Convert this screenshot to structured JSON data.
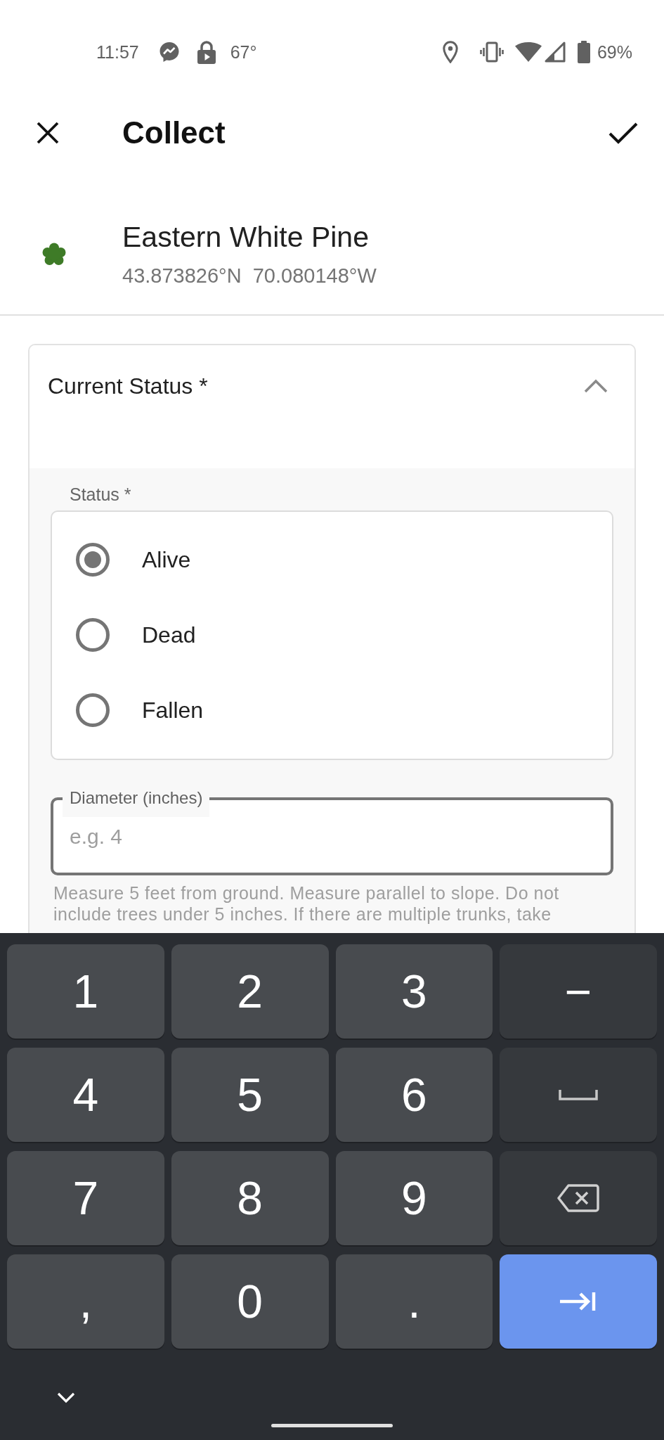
{
  "status_bar": {
    "time": "11:57",
    "temperature": "67°",
    "battery": "69%"
  },
  "app_bar": {
    "title": "Collect"
  },
  "species": {
    "name": "Eastern White Pine",
    "coordinates": "43.873826°N  70.080148°W"
  },
  "section": {
    "title": "Current Status *",
    "expanded": true,
    "status": {
      "label": "Status *",
      "options": [
        {
          "label": "Alive",
          "selected": true
        },
        {
          "label": "Dead",
          "selected": false
        },
        {
          "label": "Fallen",
          "selected": false
        }
      ]
    },
    "diameter": {
      "label": "Diameter (inches)",
      "placeholder": "e.g. 4",
      "focused": true,
      "help": "Measure 5 feet from ground. Measure parallel to slope. Do not include trees under 5 inches. If there are multiple trunks, take"
    }
  },
  "keyboard": {
    "rows": [
      [
        {
          "kind": "char",
          "label": "1"
        },
        {
          "kind": "char",
          "label": "2"
        },
        {
          "kind": "char",
          "label": "3"
        },
        {
          "kind": "symbol",
          "label": "−"
        }
      ],
      [
        {
          "kind": "char",
          "label": "4"
        },
        {
          "kind": "char",
          "label": "5"
        },
        {
          "kind": "char",
          "label": "6"
        },
        {
          "kind": "space"
        }
      ],
      [
        {
          "kind": "char",
          "label": "7"
        },
        {
          "kind": "char",
          "label": "8"
        },
        {
          "kind": "char",
          "label": "9"
        },
        {
          "kind": "backspace"
        }
      ],
      [
        {
          "kind": "char",
          "label": ","
        },
        {
          "kind": "char",
          "label": "0"
        },
        {
          "kind": "char",
          "label": "."
        },
        {
          "kind": "next"
        }
      ]
    ]
  }
}
